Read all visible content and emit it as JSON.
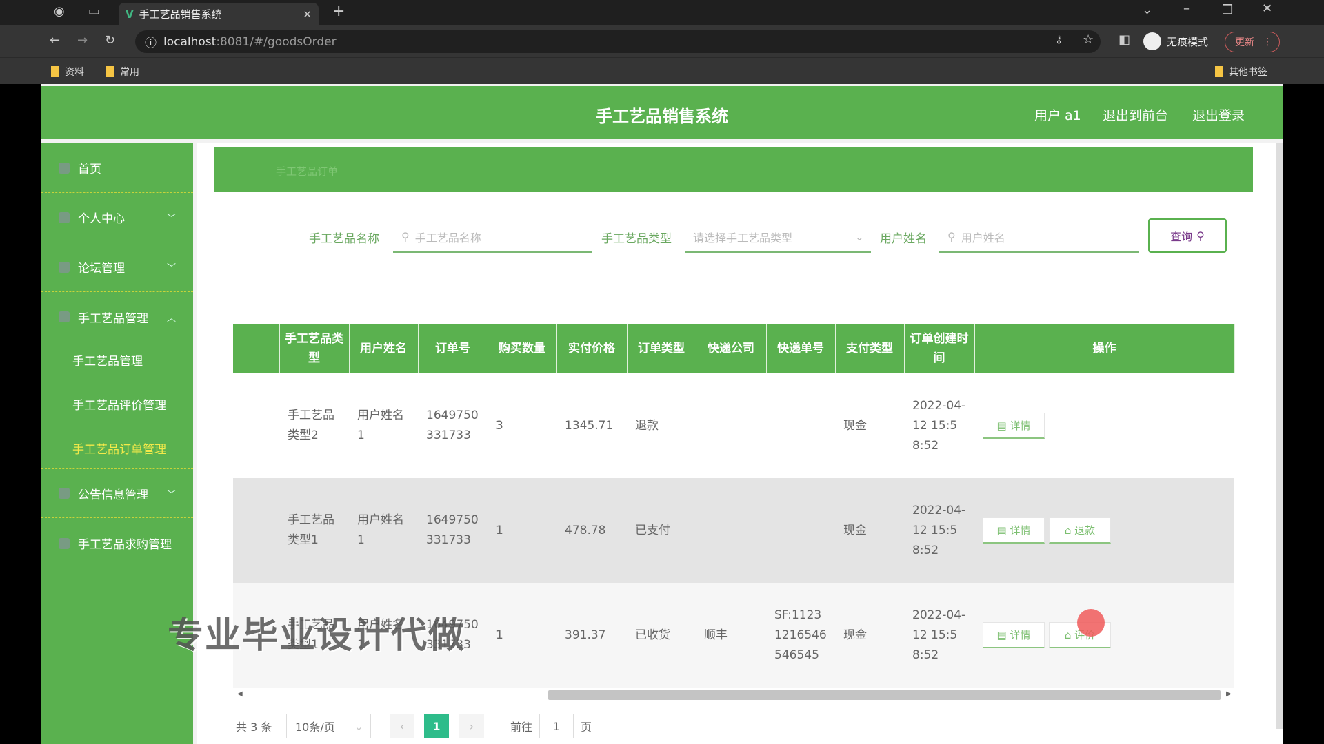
{
  "browser": {
    "tab_title": "手工艺品销售系统",
    "url_host": "localhost",
    "url_rest": ":8081/#/goodsOrder",
    "incognito": "无痕模式",
    "update": "更新",
    "bookmarks": [
      "资料",
      "常用"
    ],
    "other_bookmarks": "其他书签"
  },
  "header": {
    "title": "手工艺品销售系统",
    "user": "用户 a1",
    "to_front": "退出到前台",
    "logout": "退出登录"
  },
  "sidebar": {
    "items": [
      {
        "label": "首页"
      },
      {
        "label": "个人中心"
      },
      {
        "label": "论坛管理"
      },
      {
        "label": "手工艺品管理"
      },
      {
        "label": "公告信息管理"
      },
      {
        "label": "手工艺品求购管理"
      }
    ],
    "sub": [
      "手工艺品管理",
      "手工艺品评价管理",
      "手工艺品订单管理"
    ]
  },
  "breadcrumb": "手工艺品订单",
  "search": {
    "name_label": "手工艺品名称",
    "name_placeholder": "手工艺品名称",
    "type_label": "手工艺品类型",
    "type_placeholder": "请选择手工艺品类型",
    "user_label": "用户姓名",
    "user_placeholder": "用户姓名",
    "query": "查询"
  },
  "table": {
    "columns": [
      "",
      "手工艺品类型",
      "用户姓名",
      "订单号",
      "购买数量",
      "实付价格",
      "订单类型",
      "快递公司",
      "快递单号",
      "支付类型",
      "订单创建时间",
      "操作"
    ],
    "rows": [
      {
        "type": "手工艺品类型2",
        "user": "用户姓名1",
        "order": "1649750331733",
        "qty": "3",
        "price": "1345.71",
        "status": "退款",
        "express": "",
        "express_no": "",
        "pay": "现金",
        "time": "2022-04-12 15:58:52",
        "actions": [
          "详情"
        ]
      },
      {
        "type": "手工艺品类型1",
        "user": "用户姓名1",
        "order": "1649750331733",
        "qty": "1",
        "price": "478.78",
        "status": "已支付",
        "express": "",
        "express_no": "",
        "pay": "现金",
        "time": "2022-04-12 15:58:52",
        "actions": [
          "详情",
          "退款"
        ]
      },
      {
        "type": "手工艺品类型1",
        "user": "用户姓名1",
        "order": "1649750331733",
        "qty": "1",
        "price": "391.37",
        "status": "已收货",
        "express": "顺丰",
        "express_no": "SF:11231216546546545",
        "pay": "现金",
        "time": "2022-04-12 15:58:52",
        "actions": [
          "详情",
          "评价"
        ]
      }
    ]
  },
  "pagination": {
    "total": "共 3 条",
    "page_size": "10条/页",
    "current": "1",
    "goto": "前往",
    "goto_value": "1",
    "page_suffix": "页"
  },
  "watermark": "专业毕业设计代做",
  "colors": {
    "primary": "#5ab14f",
    "active_menu": "#f2e94a",
    "page_btn": "#2ebc8a"
  }
}
